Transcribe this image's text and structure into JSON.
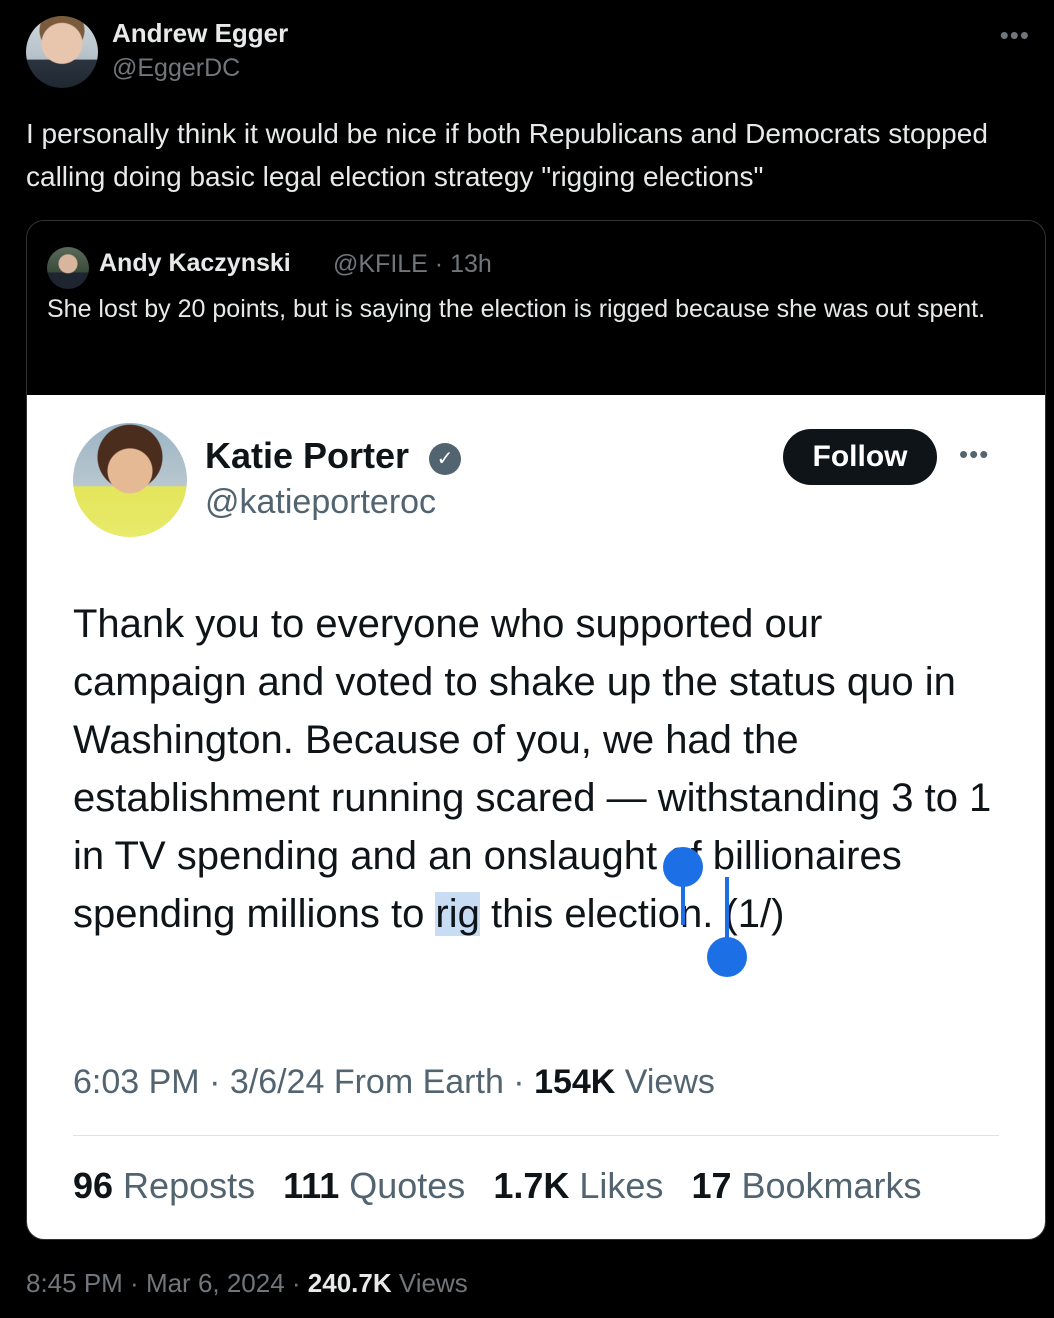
{
  "tweet": {
    "author_name": "Andrew Egger",
    "author_handle": "@EggerDC",
    "more_icon": "more-dots-icon",
    "text": "I personally think it would be nice if both Republicans and Democrats stopped calling doing basic legal election strategy \"rigging elections\"",
    "footer": {
      "time": "8:45 PM",
      "sep1": " · ",
      "date": "Mar 6, 2024",
      "sep2": " · ",
      "views_count": "240.7K",
      "views_label": " Views"
    }
  },
  "quote": {
    "author_name": "Andy Kaczynski",
    "meta": "@KFILE · 13h",
    "text": "She lost by 20 points, but is saying the election is rigged because she was out spent."
  },
  "embedded": {
    "author_name": "Katie Porter",
    "author_handle": "@katieporteroc",
    "verified_icon": "verified-badge-icon",
    "follow_label": "Follow",
    "more_icon": "more-dots-icon",
    "text_before": "Thank you to everyone who supported our campaign and voted to shake up the status quo in Washington. Because of you, we had the establishment running scared — withstanding 3 to 1 in TV spending and an onslaught of billionaires spending millions to ",
    "text_selected": "rig",
    "text_after": " this election. (1/)",
    "meta_time": "6:03 PM",
    "meta_sep1": " · ",
    "meta_date": "3/6/24",
    "meta_source": " From Earth",
    "meta_sep2": " · ",
    "meta_views_count": "154K",
    "meta_views_label": " Views",
    "stats": [
      {
        "count": "96",
        "label": " Reposts"
      },
      {
        "count": "111",
        "label": " Quotes"
      },
      {
        "count": "1.7K",
        "label": " Likes"
      },
      {
        "count": "17",
        "label": " Bookmarks"
      }
    ]
  },
  "colors": {
    "background": "#000000",
    "text_primary": "#e7e9ea",
    "text_secondary": "#71767b",
    "selection_handle": "#1d6fe6"
  }
}
